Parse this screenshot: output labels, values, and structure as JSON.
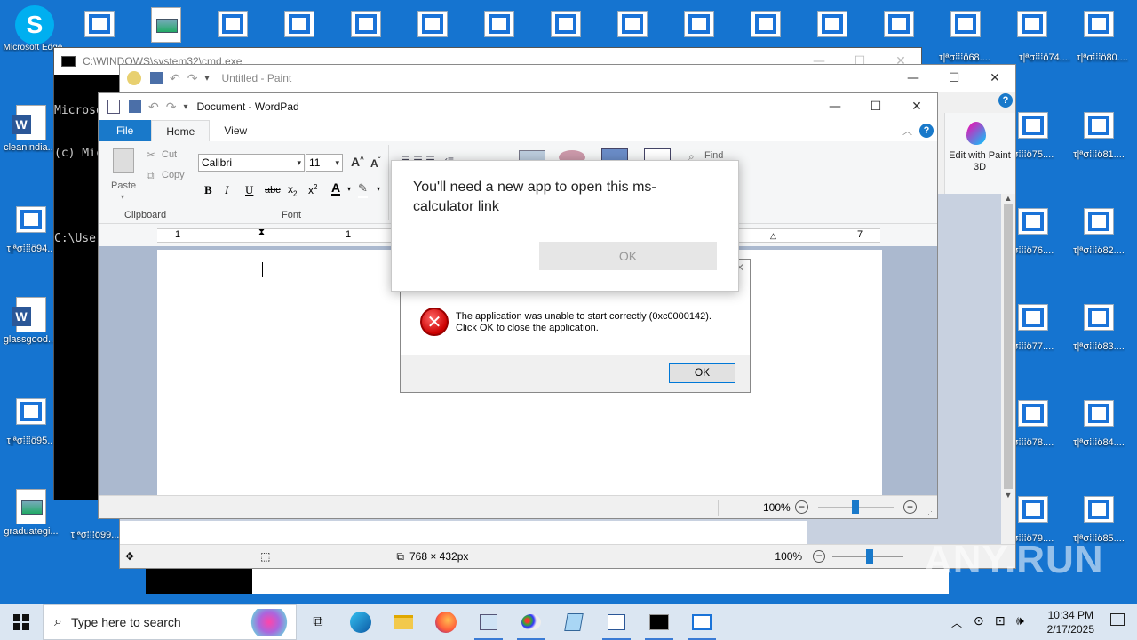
{
  "desktop": {
    "left_icons": [
      {
        "label": "Skype",
        "type": "skype"
      },
      {
        "label": "cleanindia....",
        "type": "word"
      },
      {
        "label": "τ|ªσ⁞⁞⁞ö94...",
        "type": "win"
      },
      {
        "label": "glassgood....",
        "type": "word"
      },
      {
        "label": "τ|ªσ⁞⁞⁞ö95...",
        "type": "win"
      },
      {
        "label": "graduategi...",
        "type": "pic"
      }
    ],
    "left_icon_overlap_labels": [
      "τ|ªσ⁞⁞⁞ö99...",
      "Microsoft Edge"
    ],
    "right_icons_col1": [
      "σ⁞⁞⁞ö75....",
      "σ⁞⁞⁞ö76....",
      "σ⁞⁞⁞ö77....",
      "σ⁞⁞⁞ö78....",
      "σ⁞⁞⁞ö79...."
    ],
    "right_icons_col2": [
      "τ|ªσ⁞⁞⁞ö80....",
      "τ|ªσ⁞⁞⁞ö81....",
      "τ|ªσ⁞⁞⁞ö82....",
      "τ|ªσ⁞⁞⁞ö83....",
      "τ|ªσ⁞⁞⁞ö84....",
      "τ|ªσ⁞⁞⁞ö85...."
    ],
    "top_row_labels": [
      "τ|ªσ⁞⁞⁞ö68....",
      "τ|ªσ⁞⁞⁞ö74...."
    ]
  },
  "cmd": {
    "title": "C:\\WINDOWS\\system32\\cmd.exe",
    "lines": [
      "Microsoft",
      "(c) Mic",
      "",
      "C:\\User"
    ]
  },
  "paint": {
    "title": "Untitled - Paint",
    "edit_paint3d": "Edit with Paint 3D",
    "status_dims": "768 × 432px",
    "zoom": "100%"
  },
  "wordpad": {
    "title": "Document - WordPad",
    "tabs": [
      "File",
      "Home",
      "View"
    ],
    "clipboard": {
      "paste": "Paste",
      "cut": "Cut",
      "copy": "Copy",
      "group": "Clipboard"
    },
    "font": {
      "name": "Calibri",
      "size": "11",
      "group": "Font"
    },
    "editing": {
      "find": "Find"
    },
    "ruler_marks": [
      "1",
      "1",
      "7"
    ],
    "zoom": "100%"
  },
  "error_dialog": {
    "message_line1": "The application was unable to start correctly (0xc0000142).",
    "message_line2": "Click OK to close the application.",
    "ok": "OK"
  },
  "app_dialog": {
    "message": "You'll need a new app to open this ms-calculator link",
    "ok": "OK"
  },
  "taskbar": {
    "search_placeholder": "Type here to search",
    "time": "10:34 PM",
    "date": "2/17/2025"
  },
  "watermark": "ANY.RUN"
}
